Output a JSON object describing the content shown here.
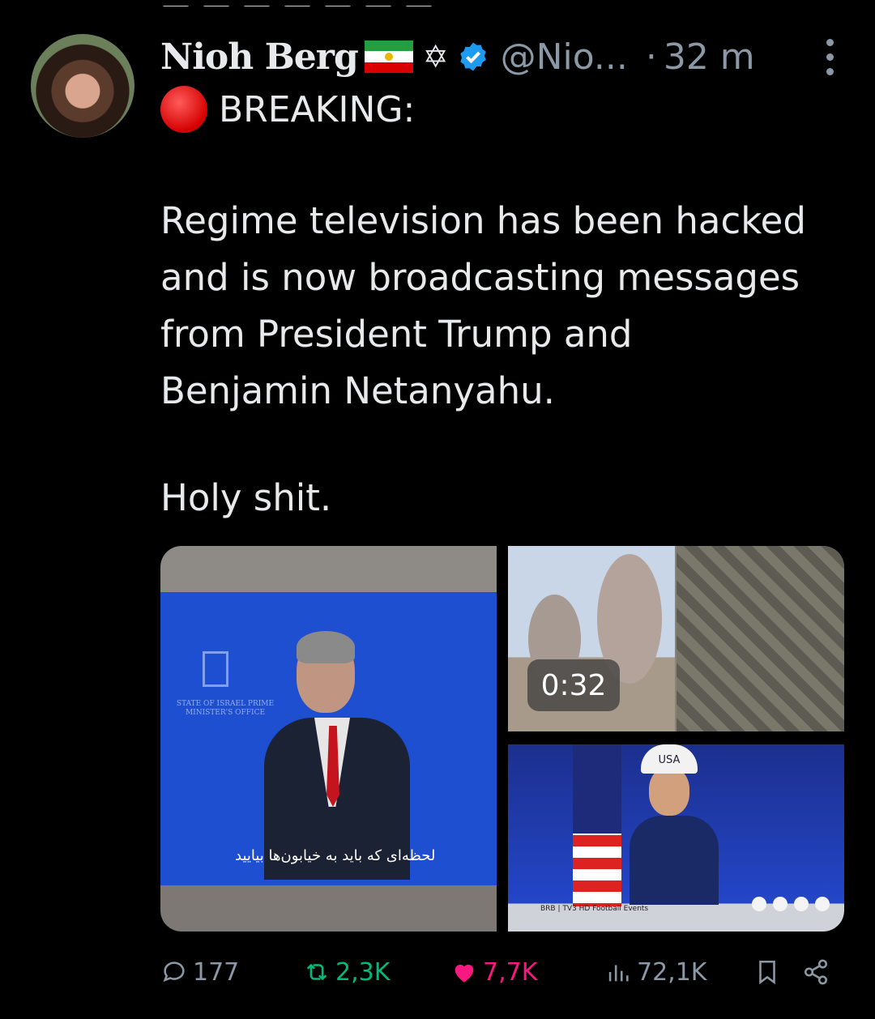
{
  "tweet": {
    "author_name": "Nioh Berg",
    "handle": "@Nio...",
    "separator": "·",
    "time": "32 m",
    "breaking_label": "BREAKING:",
    "body_lines": [
      "Regime television has been hacked",
      "and is now broadcasting messages",
      "from President Trump and",
      "Benjamin Netanyahu."
    ],
    "closing_line": "Holy shit.",
    "icons": {
      "flag": "iran-lion-sun-flag-icon",
      "star": "star-of-david-icon",
      "verified": "verified-badge-icon",
      "more": "more-vertical-icon",
      "breaking": "red-circle-icon"
    }
  },
  "media": {
    "video_duration": "0:32",
    "subtitle": "لحظه‌ای که باید به خیابون‌ها بیایید",
    "office_text": "STATE OF ISRAEL PRIME MINISTER'S OFFICE",
    "cap_text": "USA",
    "ticker_text": "BRB | TV3 HD Football Events"
  },
  "stats": {
    "replies": "177",
    "reposts": "2,3K",
    "likes": "7,7K",
    "views": "72,1K"
  },
  "colors": {
    "background": "#000000",
    "text": "#e7e9ea",
    "muted": "#8b98a5",
    "repost": "#00ba7c",
    "like": "#f91880",
    "verified": "#1d9bf0"
  }
}
